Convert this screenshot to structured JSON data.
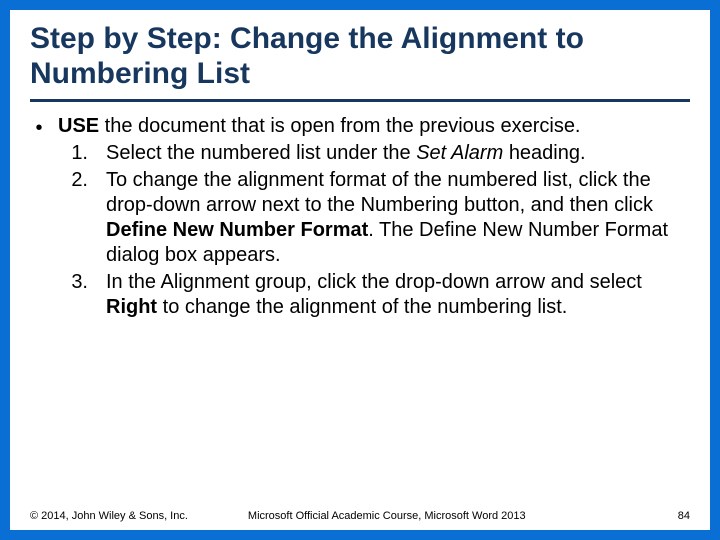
{
  "title": "Step by Step: Change the Alignment to Numbering List",
  "intro": {
    "use_label": "USE",
    "rest": " the document that is open from the previous exercise."
  },
  "steps": [
    {
      "num": "1.",
      "runs": [
        {
          "t": "Select the numbered list under the "
        },
        {
          "t": "Set Alarm ",
          "italic": true
        },
        {
          "t": "heading."
        }
      ]
    },
    {
      "num": "2.",
      "runs": [
        {
          "t": "To change the alignment format of the numbered list, click the drop-down arrow next to the Numbering button, and then click "
        },
        {
          "t": "Define New Number Format",
          "bold": true
        },
        {
          "t": ". The Define New Number Format dialog box appears."
        }
      ]
    },
    {
      "num": "3.",
      "runs": [
        {
          "t": "In the Alignment group, click the drop-down arrow and select "
        },
        {
          "t": "Right ",
          "bold": true
        },
        {
          "t": "to change the alignment of the numbering list."
        }
      ]
    }
  ],
  "footer": {
    "left": "© 2014, John Wiley & Sons, Inc.",
    "center": "Microsoft Official Academic Course, Microsoft Word 2013",
    "right": "84"
  },
  "bullet_char": "•"
}
